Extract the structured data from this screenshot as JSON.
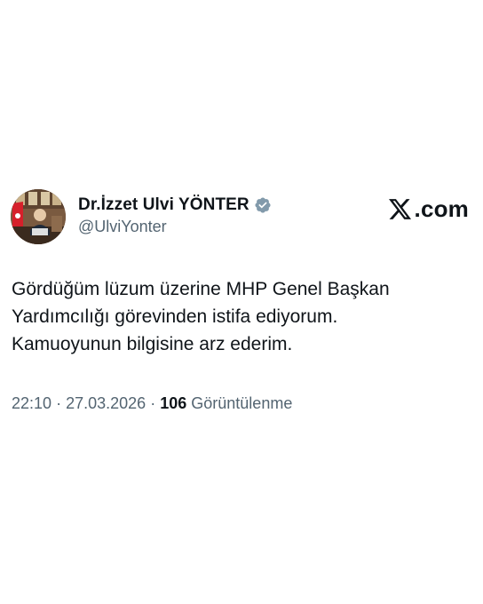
{
  "tweet": {
    "author": {
      "display_name": "Dr.İzzet Ulvi YÖNTER",
      "handle": "@UlviYonter",
      "verified": true,
      "verified_color": "#829aab"
    },
    "brand": {
      "label": ".com",
      "icon": "x-logo-icon"
    },
    "text_lines": [
      "Gördüğüm lüzum üzerine MHP Genel Başkan",
      "Yardımcılığı görevinden istifa ediyorum.",
      "Kamuoyunun bilgisine arz ederim."
    ],
    "time": "22:10",
    "separator": "·",
    "date": "27.03.2026",
    "views_count": "106",
    "views_label": "Görüntülenme"
  },
  "colors": {
    "text_primary": "#0f1419",
    "text_secondary": "#536471",
    "background": "#ffffff"
  }
}
